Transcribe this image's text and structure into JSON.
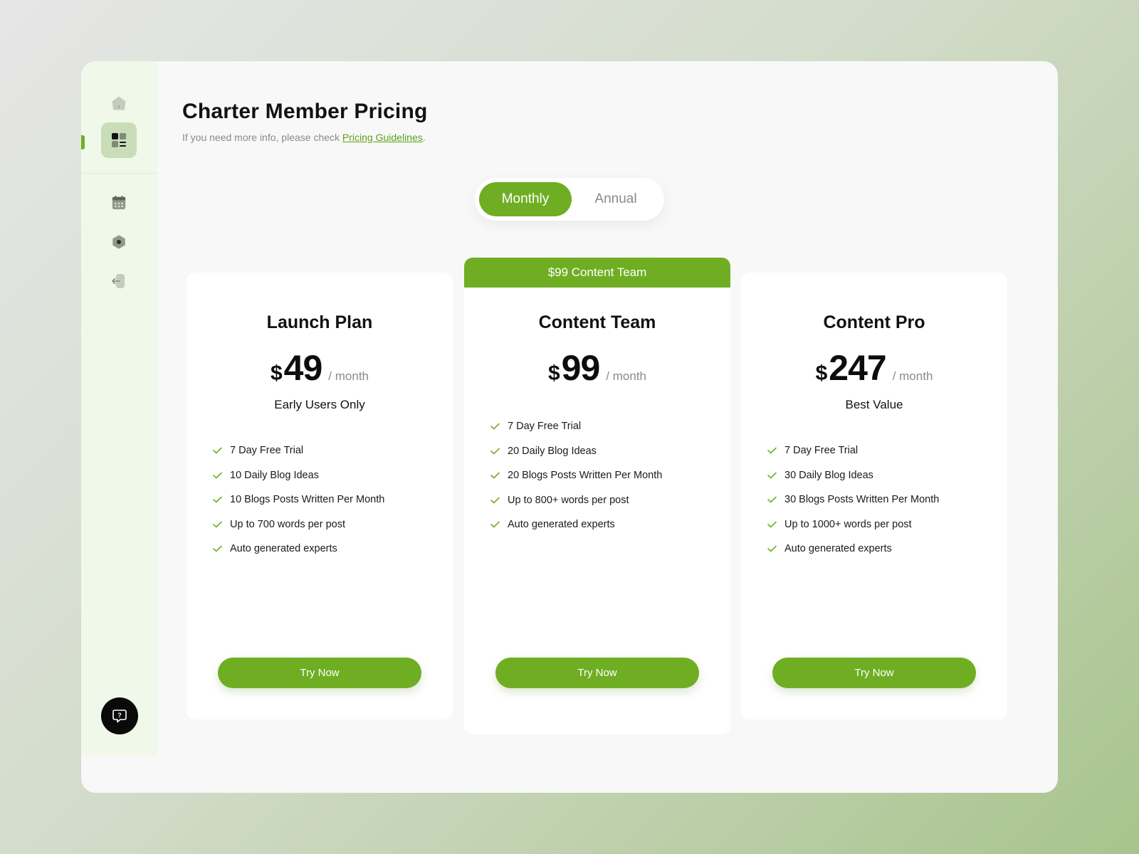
{
  "header": {
    "title": "Charter Member Pricing",
    "subtitle_prefix": "If you need more info, please check ",
    "subtitle_link": "Pricing Guidelines",
    "subtitle_suffix": "."
  },
  "billing_toggle": {
    "options": [
      "Monthly",
      "Annual"
    ],
    "selected": "Monthly"
  },
  "sidebar": {
    "items": [
      {
        "icon": "home-icon",
        "active": false
      },
      {
        "icon": "dashboard-icon",
        "active": true
      },
      {
        "icon": "calendar-icon",
        "active": false
      },
      {
        "icon": "settings-icon",
        "active": false
      },
      {
        "icon": "logout-icon",
        "active": false
      }
    ],
    "help_icon": "help-chat-icon"
  },
  "plans": [
    {
      "name": "Launch Plan",
      "currency": "$",
      "price": "49",
      "period": "/ month",
      "tag": "Early Users Only",
      "features": [
        "7 Day Free Trial",
        "10 Daily Blog Ideas",
        "10 Blogs Posts Written Per Month",
        "Up to 700 words per post",
        "Auto generated experts"
      ],
      "cta": "Try Now"
    },
    {
      "ribbon": "$99 Content Team",
      "name": "Content Team",
      "currency": "$",
      "price": "99",
      "period": "/ month",
      "tag": "",
      "features": [
        "7 Day Free Trial",
        "20 Daily Blog Ideas",
        "20 Blogs Posts Written Per Month",
        "Up to 800+ words per post",
        "Auto generated experts"
      ],
      "cta": "Try Now"
    },
    {
      "name": "Content Pro",
      "currency": "$",
      "price": "247",
      "period": "/ month",
      "tag": "Best Value",
      "features": [
        "7 Day Free Trial",
        "30 Daily Blog Ideas",
        "30 Blogs Posts Written Per Month",
        "Up to 1000+ words per post",
        "Auto generated experts"
      ],
      "cta": "Try Now"
    }
  ],
  "colors": {
    "accent": "#6fae23",
    "sidebar_bg": "#f0f9e9",
    "active_nav_bg": "#c9ddb8"
  }
}
